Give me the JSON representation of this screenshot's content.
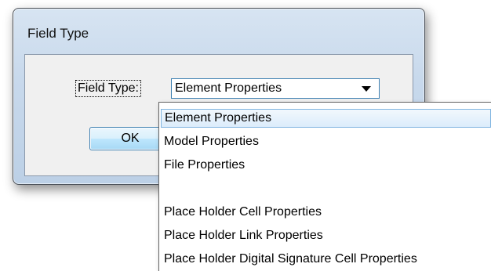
{
  "dialog": {
    "title": "Field Type",
    "field_label": "Field Type:",
    "selected_value": "Element Properties",
    "ok_label": "OK"
  },
  "dropdown": {
    "options": [
      {
        "label": "Element Properties",
        "selected": true
      },
      {
        "label": "Model Properties"
      },
      {
        "label": "File Properties"
      },
      {
        "label": ""
      },
      {
        "label": "Place Holder Cell Properties"
      },
      {
        "label": "Place Holder Link Properties"
      },
      {
        "label": "Place Holder Digital Signature Cell Properties"
      }
    ]
  },
  "colors": {
    "selection_fill": "#dcecfb",
    "selection_border": "#7fb4e0",
    "focus_border": "#3c7fb1"
  }
}
